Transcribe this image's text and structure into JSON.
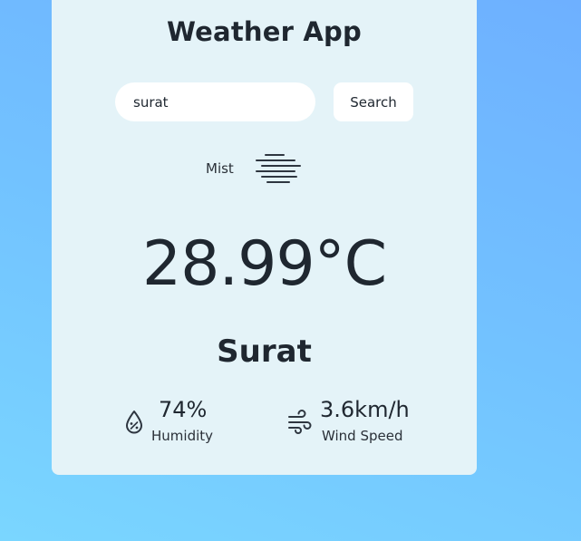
{
  "app": {
    "title": "Weather App"
  },
  "search": {
    "value": "surat",
    "button_label": "Search"
  },
  "weather": {
    "condition": "Mist",
    "condition_icon": "mist-icon",
    "temperature": "28.99°C",
    "city": "Surat"
  },
  "details": {
    "humidity": {
      "value": "74%",
      "label": "Humidity",
      "icon": "humidity-icon"
    },
    "wind": {
      "value": "3.6km/h",
      "label": "Wind Speed",
      "icon": "wind-icon"
    }
  },
  "colors": {
    "background_gradient": [
      "#6eb0ff",
      "#7ad6ff"
    ],
    "card": "#e4f3f8",
    "text": "#1f2730"
  }
}
